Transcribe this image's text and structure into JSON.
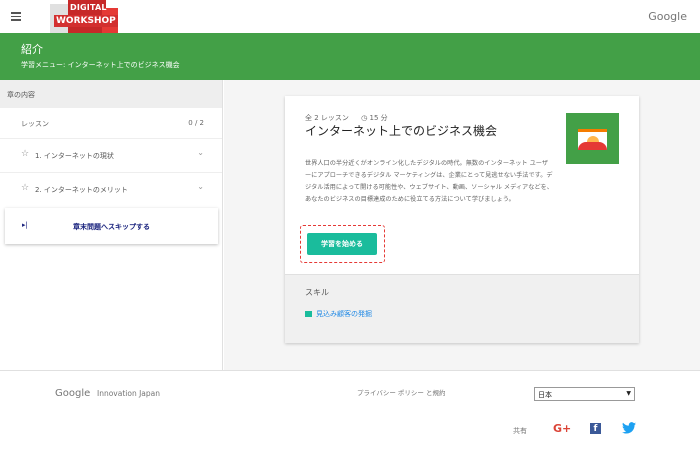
{
  "top": {
    "logo_line1": "DIGITAL",
    "logo_line2": "WORKSHOP",
    "google": "Google"
  },
  "header": {
    "title": "紹介",
    "breadcrumb": "学習メニュー: インターネット上でのビジネス機会"
  },
  "sidebar": {
    "chapter_heading": "章の内容",
    "lessons_label": "レッスン",
    "lessons_progress": "0 / 2",
    "items": [
      {
        "label": "1. インターネットの現状"
      },
      {
        "label": "2. インターネットのメリット"
      }
    ],
    "skip_label": "章末問題へスキップする"
  },
  "card": {
    "lesson_count": "全 2 レッスン",
    "duration": "15 分",
    "title": "インターネット上でのビジネス機会",
    "description": "世界人口の半分近くがオンライン化したデジタルの時代。無数のインターネット ユーザーにアプローチできるデジタル マーケティングは、企業にとって見逃せない手法です。デジタル活用によって開ける可能性や、ウェブサイト、動画、ソーシャル メディアなどを、あなたのビジネスの目標達成のために役立てる方法について学びましょう。",
    "start_label": "学習を始める",
    "skills_heading": "スキル",
    "skill_tag": "見込み顧客の発掘"
  },
  "footer": {
    "google": "Google",
    "org": "Innovation Japan",
    "privacy": "プライバシー ポリシー と規約",
    "region": "日本",
    "share": "共有",
    "gplus": "G+",
    "fb": "f"
  },
  "colors": {
    "header_green": "#43a047",
    "start_teal": "#1abc9c",
    "highlight_red": "#e53935",
    "skip_navy": "#1a237e"
  }
}
